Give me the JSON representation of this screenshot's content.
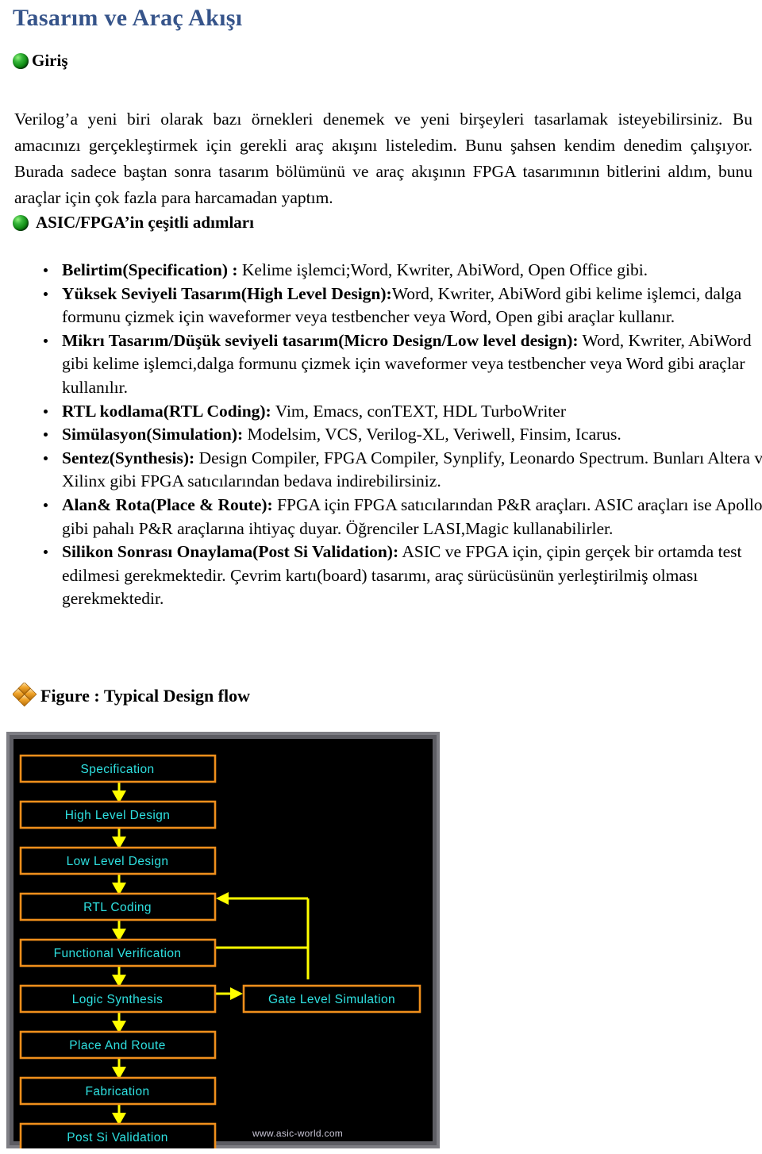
{
  "document": {
    "title": "Tasarım ve Araç Akışı",
    "sections": [
      {
        "heading": "Giriş",
        "bullet_icon": "green-sphere-icon",
        "body": "Verilog’a yeni biri olarak bazı örnekleri denemek ve yeni birşeyleri tasarlamak isteyebilirsiniz. Bu amacınızı gerçekleştirmek için gerekli araç akışını listeledim. Bunu şahsen kendim denedim çalışıyor. Burada sadece baştan sonra tasarım bölümünü ve araç akışının FPGA tasarımının bitlerini aldım, bunu araçlar için çok fazla para harcamadan yaptım."
      },
      {
        "heading": "ASIC/FPGA’in çeşitli adımları",
        "bullet_icon": "green-sphere-icon"
      }
    ],
    "steps": [
      {
        "term": "Belirtim(Specification) :",
        "desc": " Kelime işlemci;Word, Kwriter, AbiWord, Open Office gibi."
      },
      {
        "term": "Yüksek Seviyeli Tasarım(High Level Design):",
        "desc": "Word, Kwriter, AbiWord gibi kelime işlemci, dalga formunu çizmek için waveformer veya testbencher veya Word, Open gibi araçlar kullanır."
      },
      {
        "term": "Mikrı Tasarım/Düşük seviyeli tasarım(Micro Design/Low level design):",
        "desc": " Word, Kwriter, AbiWord gibi kelime işlemci,dalga formunu çizmek için waveformer veya testbencher veya Word gibi araçlar kullanılır."
      },
      {
        "term": "RTL kodlama(RTL Coding):",
        "desc": " Vim, Emacs, conTEXT, HDL TurboWriter"
      },
      {
        "term": "Simülasyon(Simulation):",
        "desc": " Modelsim, VCS, Verilog-XL, Veriwell, Finsim, Icarus."
      },
      {
        "term": "Sentez(Synthesis):",
        "desc": " Design Compiler, FPGA Compiler, Synplify, Leonardo Spectrum. Bunları Altera ve Xilinx gibi FPGA satıcılarından bedava indirebilirsiniz."
      },
      {
        "term": "Alan& Rota(Place & Route):",
        "desc": " FPGA için FPGA satıcılarından P&R araçları. ASIC araçları ise Apollo gibi pahalı P&R araçlarına ihtiyaç duyar. Öğrenciler LASI,Magic kullanabilirler."
      },
      {
        "term": "Silikon Sonrası Onaylama(Post Si Validation):",
        "desc": " ASIC ve FPGA için, çipin gerçek bir ortamda test edilmesi gerekmektedir. Çevrim kartı(board) tasarımı, araç sürücüsünün yerleştirilmiş olması gerekmektedir."
      }
    ],
    "figure": {
      "caption": "Figure : Typical Design flow",
      "bullet_icon": "diamond-cluster-icon",
      "watermark": "www.asic-world.com",
      "colors": {
        "background": "#000000",
        "frame": "#808080",
        "box_border": "#ef8f1c",
        "box_text": "#2ee0e0",
        "arrow": "#ffff00",
        "watermark_text": "#c9c6d6"
      },
      "nodes": [
        "Specification",
        "High Level Design",
        "Low Level Design",
        "RTL Coding",
        "Functional Verification",
        "Logic Synthesis",
        "Gate Level Simulation",
        "Place And Route",
        "Fabrication",
        "Post Si Validation"
      ]
    }
  }
}
